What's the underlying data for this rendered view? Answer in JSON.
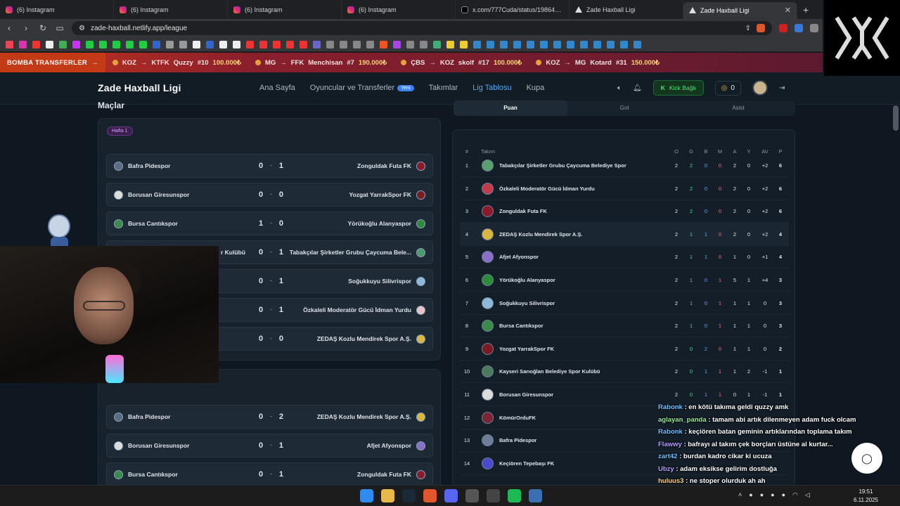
{
  "browser": {
    "tabs": [
      {
        "title": "(6) Instagram",
        "icon": "instagram-icon"
      },
      {
        "title": "(6) Instagram",
        "icon": "instagram-icon"
      },
      {
        "title": "(6) Instagram",
        "icon": "instagram-icon"
      },
      {
        "title": "(6) Instagram",
        "icon": "instagram-icon"
      },
      {
        "title": "x.com/777Cuda/status/198647142l0",
        "icon": "x-icon"
      },
      {
        "title": "Zade Haxball Ligi",
        "icon": "triangle-icon"
      },
      {
        "title": "Zade Haxball Ligi",
        "icon": "triangle-icon",
        "active": true
      }
    ],
    "url": "zade-haxball.netlify.app/league"
  },
  "ticker": {
    "label": "BOMBA TRANSFERLER",
    "arrow": "→",
    "items": [
      {
        "from": "KOZ",
        "to": "KTFK",
        "player": "Quzzy",
        "num": "#10",
        "price": "100.000₺"
      },
      {
        "from": "MG",
        "to": "FFK",
        "player": "Menchisan",
        "num": "#7",
        "price": "190.000₺"
      },
      {
        "from": "ÇBS",
        "to": "KOZ",
        "player": "skolf",
        "num": "#17",
        "price": "100.000₺"
      },
      {
        "from": "KOZ",
        "to": "MG",
        "player": "Kotard",
        "num": "#31",
        "price": "150.000₺"
      }
    ]
  },
  "header": {
    "logo": "Zade Haxball Ligi",
    "nav": [
      "Ana Sayfa",
      "Oyuncular ve Transferler",
      "Takımlar",
      "Lig Tablosu",
      "Kupa"
    ],
    "nav_badge": "Yeni",
    "kick_label": "Kick Bağlı",
    "coins": "0"
  },
  "matches": {
    "title": "Maçlar",
    "week1": {
      "label": "Hafta 1",
      "games": [
        {
          "home": "Bafra Pidespor",
          "hs": "0",
          "as": "1",
          "away": "Zonguldak Futa FK"
        },
        {
          "home": "Borusan Giresunspor",
          "hs": "0",
          "as": "0",
          "away": "Yozgat YarrakSpor FK"
        },
        {
          "home": "Bursa Cantıkspor",
          "hs": "1",
          "as": "0",
          "away": "Yörükoğlu Alanyaspor"
        },
        {
          "home": "r Kulübü",
          "hs": "0",
          "as": "1",
          "away": "Tabakçılar Şirketler Grubu Çaycuma Bele..."
        },
        {
          "home": "",
          "hs": "0",
          "as": "1",
          "away": "Soğukkuyu Silivrispor"
        },
        {
          "home": "",
          "hs": "0",
          "as": "1",
          "away": "Özkaleli Moderatör Gücü İdman Yurdu"
        },
        {
          "home": "",
          "hs": "0",
          "as": "0",
          "away": "ZEDAŞ Kozlu Mendirek Spor A.Ş."
        }
      ]
    },
    "week2": {
      "games": [
        {
          "home": "Bafra Pidespor",
          "hs": "0",
          "as": "2",
          "away": "ZEDAŞ Kozlu Mendirek Spor A.Ş."
        },
        {
          "home": "Borusan Giresunspor",
          "hs": "0",
          "as": "1",
          "away": "Afjet Afyonspor"
        },
        {
          "home": "Bursa Cantıkspor",
          "hs": "0",
          "as": "1",
          "away": "Zonguldak Futa FK"
        }
      ]
    }
  },
  "stats_tabs": [
    "Puan",
    "Gol",
    "Asist"
  ],
  "standings": {
    "headers": [
      "#",
      "Takım",
      "O",
      "G",
      "B",
      "M",
      "A",
      "Y",
      "AV",
      "P"
    ],
    "rows": [
      {
        "pos": "1",
        "team": "Tabakçılar Şirketler Grubu Çaycuma Belediye Spor",
        "o": "2",
        "g": "2",
        "b": "0",
        "m": "0",
        "a": "2",
        "y": "0",
        "av": "+2",
        "p": "6"
      },
      {
        "pos": "2",
        "team": "Özkaleli Moderatör Gücü İdman Yurdu",
        "o": "2",
        "g": "2",
        "b": "0",
        "m": "0",
        "a": "2",
        "y": "0",
        "av": "+2",
        "p": "6"
      },
      {
        "pos": "3",
        "team": "Zonguldak Futa FK",
        "o": "2",
        "g": "2",
        "b": "0",
        "m": "0",
        "a": "2",
        "y": "0",
        "av": "+2",
        "p": "6"
      },
      {
        "pos": "4",
        "team": "ZEDAŞ Kozlu Mendirek Spor A.Ş.",
        "o": "2",
        "g": "1",
        "b": "1",
        "m": "0",
        "a": "2",
        "y": "0",
        "av": "+2",
        "p": "4"
      },
      {
        "pos": "5",
        "team": "Afjet Afyonspor",
        "o": "2",
        "g": "1",
        "b": "1",
        "m": "0",
        "a": "1",
        "y": "0",
        "av": "+1",
        "p": "4"
      },
      {
        "pos": "6",
        "team": "Yörükoğlu Alanyaspor",
        "o": "2",
        "g": "1",
        "b": "0",
        "m": "1",
        "a": "5",
        "y": "1",
        "av": "+4",
        "p": "3"
      },
      {
        "pos": "7",
        "team": "Soğukkuyu Silivrispor",
        "o": "2",
        "g": "1",
        "b": "0",
        "m": "1",
        "a": "1",
        "y": "1",
        "av": "0",
        "p": "3"
      },
      {
        "pos": "8",
        "team": "Bursa Cantıkspor",
        "o": "2",
        "g": "1",
        "b": "0",
        "m": "1",
        "a": "1",
        "y": "1",
        "av": "0",
        "p": "3"
      },
      {
        "pos": "9",
        "team": "Yozgat YarrakSpor FK",
        "o": "2",
        "g": "0",
        "b": "2",
        "m": "0",
        "a": "1",
        "y": "1",
        "av": "0",
        "p": "2"
      },
      {
        "pos": "10",
        "team": "Kayseri Sarıoğlan Belediye Spor Kulübü",
        "o": "2",
        "g": "0",
        "b": "1",
        "m": "1",
        "a": "1",
        "y": "2",
        "av": "-1",
        "p": "1"
      },
      {
        "pos": "11",
        "team": "Borusan Giresunspor",
        "o": "2",
        "g": "0",
        "b": "1",
        "m": "1",
        "a": "0",
        "y": "1",
        "av": "-1",
        "p": "1"
      },
      {
        "pos": "12",
        "team": "KömürOrduFK",
        "o": "",
        "g": "",
        "b": "",
        "m": "",
        "a": "",
        "y": "",
        "av": "",
        "p": ""
      },
      {
        "pos": "13",
        "team": "Bafra Pidespor",
        "o": "",
        "g": "",
        "b": "",
        "m": "",
        "a": "",
        "y": "",
        "av": "",
        "p": ""
      },
      {
        "pos": "14",
        "team": "Keçiören Tepebaşı FK",
        "o": "",
        "g": "",
        "b": "",
        "m": "",
        "a": "",
        "y": "",
        "av": "",
        "p": ""
      }
    ]
  },
  "chat": [
    {
      "user": "Rabonk",
      "msg": ": en kötü takıma geldi quzzy amk"
    },
    {
      "user": "aglayan_panda",
      "msg": ": tamam abi artık dilenmeyen adam    fuck olcam"
    },
    {
      "user": "Rabonk",
      "msg": ": keçiören batan geminin artıklarından toplama takım"
    },
    {
      "user": "Flawwy",
      "msg": ": bafrayı al takım çek borçları üstüne al kurtar..."
    },
    {
      "user": "zart42",
      "msg": ": burdan kadro cikar ki ucuza"
    },
    {
      "user": "Ubzy",
      "msg": ": adam eksikse gelirim dostluğa"
    },
    {
      "user": "huluus3",
      "msg": ": ne stoper olurduk ah ah"
    }
  ],
  "taskbar": {
    "time": "19:51",
    "date": "6.11.2025"
  }
}
